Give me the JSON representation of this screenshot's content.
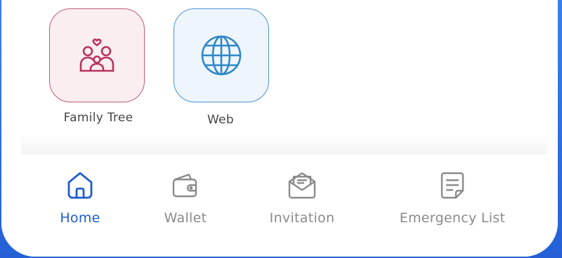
{
  "apps": [
    {
      "label": "Family Tree",
      "icon": "family-heart-icon",
      "accent": "#b8325a"
    },
    {
      "label": "Web",
      "icon": "globe-icon",
      "accent": "#2e88c8"
    }
  ],
  "bottom_nav": {
    "items": [
      {
        "label": "Home",
        "icon": "home-icon",
        "active": true
      },
      {
        "label": "Wallet",
        "icon": "wallet-icon",
        "active": false
      },
      {
        "label": "Invitation",
        "icon": "mail-open-icon",
        "active": false
      },
      {
        "label": "Emergency List",
        "icon": "document-list-icon",
        "active": false
      }
    ],
    "active_color": "#1f5ccc",
    "inactive_color": "#8a8a8a"
  }
}
